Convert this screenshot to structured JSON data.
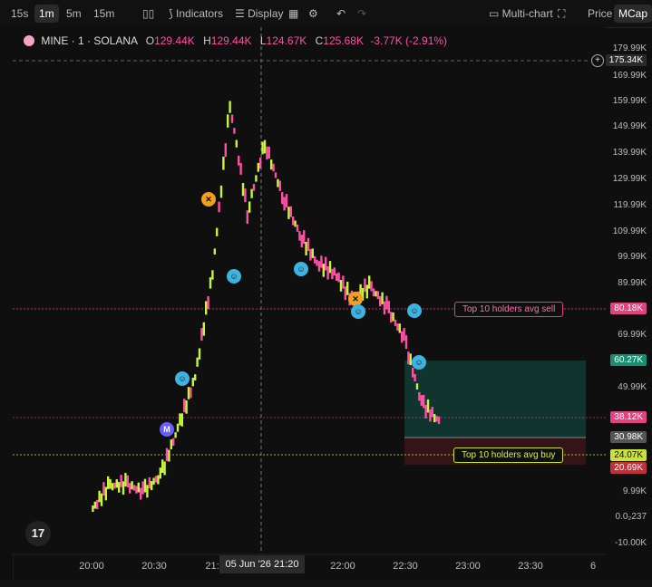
{
  "toolbar": {
    "timeframes": [
      "15s",
      "1m",
      "5m",
      "15m"
    ],
    "active_timeframe": "1m",
    "indicators_label": "Indicators",
    "display_label": "Display",
    "multichart_label": "Multi-chart",
    "price_tab": "Price",
    "mcap_tab": "MCap"
  },
  "legend": {
    "symbol": "MINE · 1 · SOLANA",
    "o_key": "O",
    "o_val": "129.44K",
    "h_key": "H",
    "h_val": "129.44K",
    "l_key": "L",
    "l_val": "124.67K",
    "c_key": "C",
    "c_val": "125.68K",
    "change": "-3.77K (-2.91%)"
  },
  "y_axis_labels": [
    "179.99K",
    "169.99K",
    "159.99K",
    "149.99K",
    "139.99K",
    "129.99K",
    "119.99K",
    "109.99K",
    "99.99K",
    "89.99K",
    "69.99K",
    "49.99K",
    "9.99K",
    "0.0₂237",
    "-10.00K"
  ],
  "price_tags": {
    "crosshair": "175.34K",
    "sell_avg": "80.18K",
    "tp": "60.27K",
    "current": "38.12K",
    "entry": "30.98K",
    "buy_avg": "24.07K",
    "sl": "20.69K"
  },
  "holders": {
    "sell_label": "Top 10 holders avg sell",
    "buy_label": "Top 10 holders avg buy"
  },
  "time_axis": [
    "20:00",
    "20:30",
    "21:",
    "22:00",
    "22:30",
    "23:00",
    "23:30",
    "6"
  ],
  "crosshair_time": "05 Jun '26   21:20",
  "markers": {
    "m_label": "M"
  },
  "tv_logo": "17",
  "colors": {
    "up": "#c6f53a",
    "down": "#ff4fa3",
    "sell_line": "#e0437f",
    "buy_line": "#c9e13b",
    "tp_zone": "#0f3a32",
    "sl_zone": "#3a1518"
  },
  "chart_data": {
    "type": "line",
    "x": [
      "19:57",
      "20:05",
      "20:15",
      "20:30",
      "20:40",
      "20:50",
      "21:00",
      "21:05",
      "21:10",
      "21:15",
      "21:20",
      "21:30",
      "21:40",
      "21:50",
      "22:00",
      "22:10",
      "22:20",
      "22:30",
      "22:35",
      "22:40",
      "22:45"
    ],
    "series": [
      {
        "values": [
          3,
          13,
          14,
          11,
          17,
          35,
          55,
          95,
          160,
          118,
          145,
          125,
          110,
          99,
          95,
          85,
          90,
          82,
          70,
          45,
          38
        ]
      }
    ],
    "ylim": [
      -10000,
      185000
    ]
  }
}
